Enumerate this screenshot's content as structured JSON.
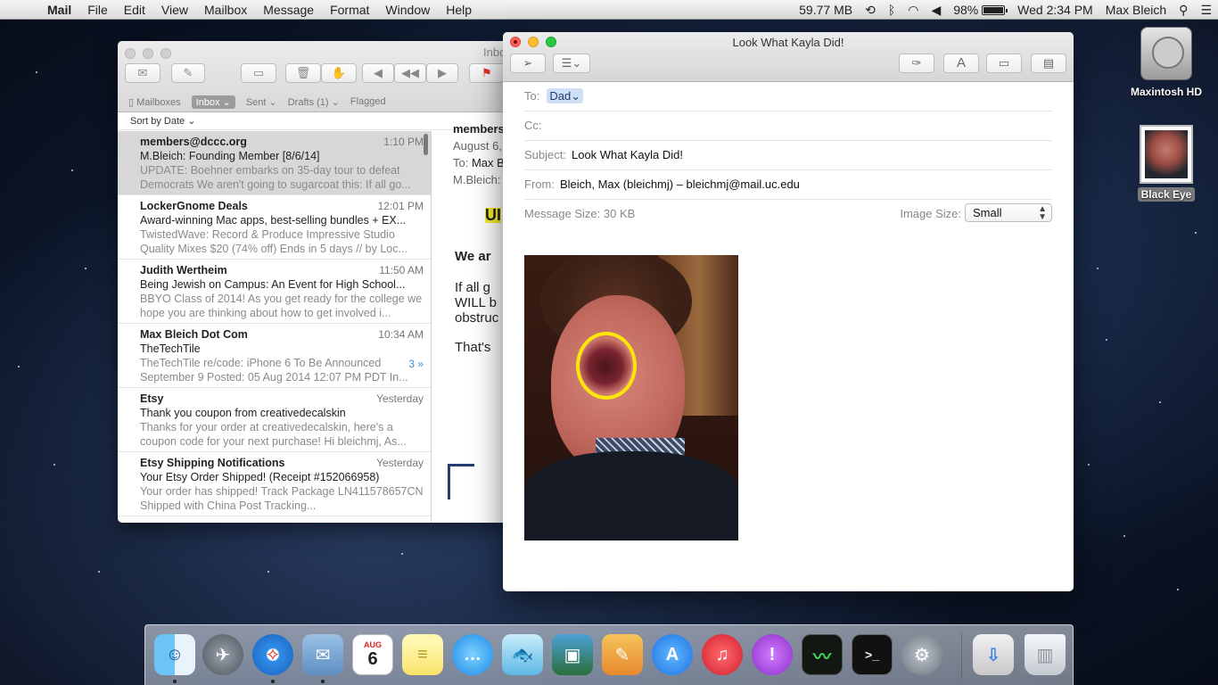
{
  "menubar": {
    "apple": "",
    "items": [
      "Mail",
      "File",
      "Edit",
      "View",
      "Mailbox",
      "Message",
      "Format",
      "Window",
      "Help"
    ],
    "memory": "59.77 MB",
    "battery": "98%",
    "battery_level": 0.98,
    "clock": "Wed 2:34 PM",
    "user": "Max Bleich"
  },
  "desktop": {
    "hd_label": "Maxintosh HD",
    "photo_label": "Black Eye"
  },
  "inbox_window": {
    "title": "Inbo",
    "favorites": {
      "mailboxes": "Mailboxes",
      "inbox": "Inbox ⌄",
      "sent": "Sent ⌄",
      "drafts": "Drafts (1) ⌄",
      "flagged": "Flagged"
    },
    "sort_label": "Sort by Date ⌄",
    "messages": [
      {
        "from": "members@dccc.org",
        "time": "1:10 PM",
        "subject": "M.Bleich: Founding Member [8/6/14]",
        "preview": "UPDATE: Boehner embarks on 35-day tour to defeat Democrats We aren't going to sugarcoat this: If all go..."
      },
      {
        "from": "LockerGnome Deals",
        "time": "12:01 PM",
        "subject": "Award-winning Mac apps, best-selling bundles + EX...",
        "preview": "TwistedWave: Record & Produce Impressive Studio Quality Mixes $20 (74% off) Ends in 5 days // by Loc..."
      },
      {
        "from": "Judith Wertheim",
        "time": "11:50 AM",
        "subject": "Being Jewish on Campus: An Event for High School...",
        "preview": "BBYO Class of 2014! As you get ready for the college we hope you are thinking about how to get involved i..."
      },
      {
        "from": "Max Bleich Dot Com",
        "time": "10:34 AM",
        "subject": "TheTechTile",
        "count": "3 »",
        "preview": "TheTechTile re/code: iPhone 6 To Be Announced September 9 Posted: 05 Aug 2014 12:07 PM PDT In..."
      },
      {
        "from": "Etsy",
        "time": "Yesterday",
        "subject": "Thank you coupon from creativedecalskin",
        "preview": "Thanks for your order at creativedecalskin, here's a coupon code for your next purchase! Hi bleichmj, As..."
      },
      {
        "from": "Etsy Shipping Notifications",
        "time": "Yesterday",
        "subject": "Your Etsy Order Shipped! (Receipt #152066958)",
        "preview": "Your order has shipped! Track Package LN411578657CN Shipped with China Post Tracking..."
      }
    ],
    "reader": {
      "from": "members",
      "date": "August 6,",
      "to_label": "To:",
      "to_value": "Max B",
      "subject_prefix": "M.Bleich:",
      "headline": "UI",
      "body_bold": "We ar",
      "body_lines": [
        "If all g",
        "WILL b",
        "obstruc"
      ],
      "body_last": "That's"
    }
  },
  "compose_window": {
    "title": "Look What Kayla Did!",
    "to_label": "To:",
    "to_value": "Dad",
    "to_chevron": "⌄",
    "cc_label": "Cc:",
    "subject_label": "Subject:",
    "subject_value": "Look What Kayla Did!",
    "from_label": "From:",
    "from_value": "Bleich, Max (bleichmj) – bleichmj@mail.uc.edu",
    "message_size": "Message Size: 30 KB",
    "image_size_label": "Image Size:",
    "image_size_value": "Small"
  },
  "dock": {
    "items": [
      "finder",
      "launchpad",
      "safari",
      "mail",
      "calendar",
      "notes",
      "messages",
      "aquarium",
      "iphoto",
      "pages",
      "app-store",
      "itunes",
      "feedback",
      "activity-monitor",
      "terminal",
      "system-preferences",
      "downloads",
      "trash"
    ],
    "calendar_month": "AUG",
    "calendar_day": "6"
  },
  "colors": {
    "selection": "#cfe0f6",
    "flag": "#e53028",
    "close": "#fc5f57",
    "minimize": "#fdbc2e",
    "zoom": "#28c840"
  }
}
